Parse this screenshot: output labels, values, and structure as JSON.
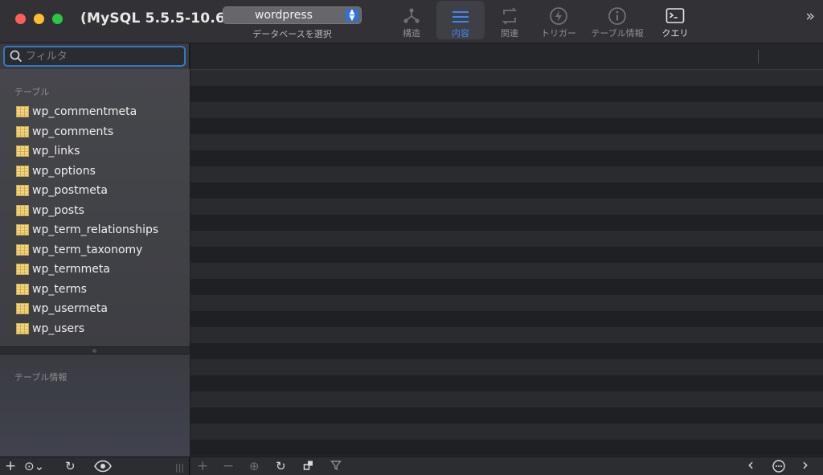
{
  "window": {
    "title": "(MySQL 5.5.5-10.6....",
    "database_select": {
      "value": "wordpress",
      "caption": "データベースを選択"
    }
  },
  "toolbar": {
    "items": [
      {
        "label": "構造",
        "icon": "structure-icon",
        "state": "disabled"
      },
      {
        "label": "内容",
        "icon": "list-icon",
        "state": "active"
      },
      {
        "label": "関連",
        "icon": "relations-icon",
        "state": "disabled"
      },
      {
        "label": "トリガー",
        "icon": "bolt-icon",
        "state": "disabled"
      },
      {
        "label": "テーブル情報",
        "icon": "info-icon",
        "state": "disabled"
      },
      {
        "label": "クエリ",
        "icon": "terminal-icon",
        "state": "enabled"
      }
    ],
    "overflow": "»"
  },
  "sidebar": {
    "filter_placeholder": "フィルタ",
    "tables_label": "テーブル",
    "tables": [
      "wp_commentmeta",
      "wp_comments",
      "wp_links",
      "wp_options",
      "wp_postmeta",
      "wp_posts",
      "wp_term_relationships",
      "wp_term_taxonomy",
      "wp_termmeta",
      "wp_terms",
      "wp_usermeta",
      "wp_users"
    ],
    "info_label": "テーブル情報"
  },
  "sidebar_bottom": {
    "add": "+",
    "more": "⊙⌄",
    "refresh": "↻",
    "view": "👁",
    "handle": "|||"
  },
  "content_bottom": {
    "add_row": "+",
    "remove_row": "−",
    "duplicate_row": "⊕",
    "refresh": "↻",
    "prev_page": "‹",
    "next_page": "›"
  },
  "colors": {
    "accent": "#3478c6",
    "active_tab_label": "#3f86f5",
    "close": "#fe5f57",
    "minimize": "#febc2e",
    "maximize": "#28c840",
    "table_icon": "#f5d883"
  }
}
